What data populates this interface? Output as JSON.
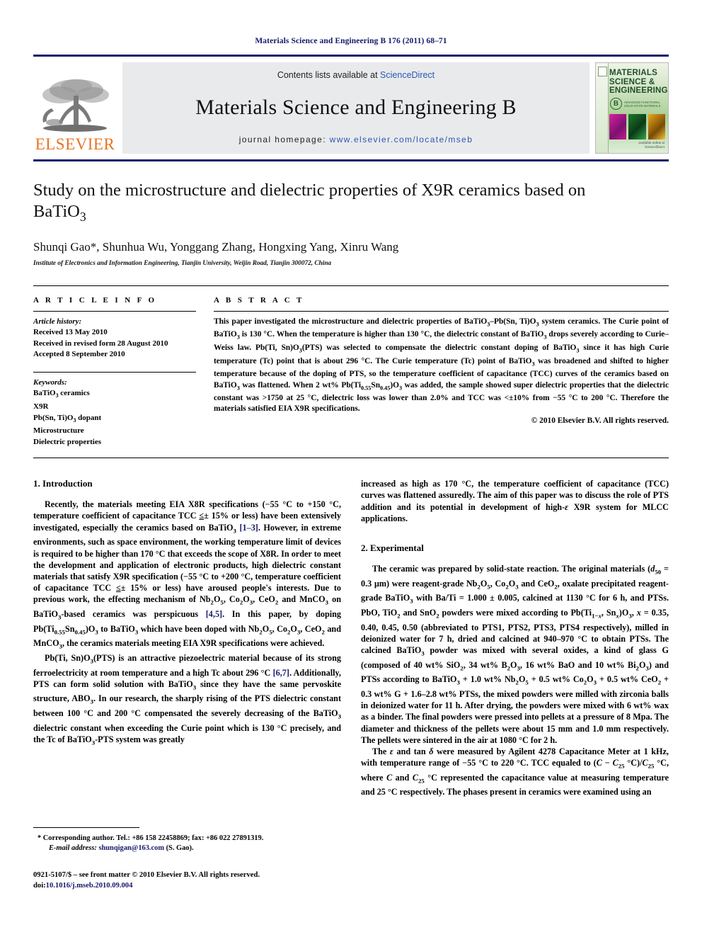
{
  "running_head": "Materials Science and Engineering B 176 (2011) 68–71",
  "masthead": {
    "publisher_name": "ELSEVIER",
    "contents_prefix": "Contents lists available at ",
    "contents_link": "ScienceDirect",
    "journal_title": "Materials Science and Engineering B",
    "homepage_prefix": "journal homepage:",
    "homepage_url": "www.elsevier.com/locate/mseb",
    "cover": {
      "title_line1": "MATERIALS",
      "title_line2": "SCIENCE &",
      "title_line3": "ENGINEERING",
      "series_letter": "B",
      "badge_line1": "ADVANCED FUNCTIONAL",
      "badge_line2": "SOLID-STATE MATERIALS",
      "foot_line1": "available online at",
      "foot_line2": "ScienceDirect"
    }
  },
  "article": {
    "title_part1": "Study on the microstructure and dielectric properties of X9R ceramics based on",
    "title_part2_pre": "BaTiO",
    "title_part2_sub": "3",
    "authors": "Shunqi Gao*, Shunhua Wu, Yonggang Zhang, Hongxing Yang, Xinru Wang",
    "affiliation": "Institute of Electronics and Information Engineering, Tianjin University, Weijin Road, Tianjin 300072, China"
  },
  "article_info": {
    "heading": "A R T I C L E   I N F O",
    "history_title": "Article history:",
    "history": [
      "Received 13 May 2010",
      "Received in revised form 28 August 2010",
      "Accepted 8 September 2010"
    ],
    "keywords_title": "Keywords:",
    "keywords": [
      "BaTiO3 ceramics",
      "X9R",
      "Pb(Sn, Ti)O3 dopant",
      "Microstructure",
      "Dielectric properties"
    ]
  },
  "abstract": {
    "heading": "A B S T R A C T",
    "text": "This paper investigated the microstructure and dielectric properties of BaTiO3–Pb(Sn, Ti)O3 system ceramics. The Curie point of BaTiO3 is 130 °C. When the temperature is higher than 130 °C, the dielectric constant of BaTiO3 drops severely according to Curie–Weiss law. Pb(Ti, Sn)O3(PTS) was selected to compensate the dielectric constant doping of BaTiO3 since it has high Curie temperature (Tc) point that is about 296 °C. The Curie temperature (Tc) point of BaTiO3 was broadened and shifted to higher temperature because of the doping of PTS, so the temperature coefficient of capacitance (TCC) curves of the ceramics based on BaTiO3 was flattened. When 2 wt% Pb(Ti0.55Sn0.45)O3 was added, the sample showed super dielectric properties that the dielectric constant was >1750 at 25 °C, dielectric loss was lower than 2.0% and TCC was <±10% from −55 °C to 200 °C. Therefore the materials satisfied EIA X9R specifications.",
    "copyright": "© 2010 Elsevier B.V. All rights reserved."
  },
  "sections": {
    "introduction_heading": "1.  Introduction",
    "experimental_heading": "2.  Experimental",
    "intro_p1": "Recently, the materials meeting EIA X8R specifications (−55 °C to +150 °C, temperature coefficient of capacitance TCC ≤± 15% or less) have been extensively investigated, especially the ceramics based on BaTiO3 [1–3]. However, in extreme environments, such as space environment, the working temperature limit of devices is required to be higher than 170 °C that exceeds the scope of X8R. In order to meet the development and application of electronic products, high dielectric constant materials that satisfy X9R specification (−55 °C to +200 °C, temperature coefficient of capacitance TCC ≤± 15% or less) have aroused people's interests. Due to previous work, the effecting mechanism of Nb2O5, Co2O3, CeO2 and MnCO3 on BaTiO3-based ceramics was perspicuous [4,5]. In this paper, by doping Pb(Ti0.55Sn0.45)O3 to BaTiO3 which have been doped with Nb2O5, Co2O3, CeO2 and MnCO3, the ceramics materials meeting EIA X9R specifications were achieved.",
    "intro_p2": "Pb(Ti, Sn)O3(PTS) is an attractive piezoelectric material because of its strong ferroelectricity at room temperature and a high Tc about 296 °C [6,7]. Additionally, PTS can form solid solution with BaTiO3 since they have the same pervoskite structure, ABO3. In our research, the sharply rising of the PTS dielectric constant between 100 °C and 200 °C compensated the severely decreasing of the BaTiO3 dielectric constant when exceeding the Curie point which is 130 °C precisely, and the Tc of BaTiO3-PTS system was greatly increased as high as 170 °C, the temperature coefficient of capacitance (TCC) curves was flattened assuredly. The aim of this paper was to discuss the role of PTS addition and its potential in development of high-ε X9R system for MLCC applications.",
    "exp_p1": "The ceramic was prepared by solid-state reaction. The original materials (d50 = 0.3 μm) were reagent-grade Nb2O5, Co2O3 and CeO2, oxalate precipitated reagent-grade BaTiO3 with Ba/Ti = 1.000 ± 0.005, calcined at 1130 °C for 6 h, and PTSs. PbO, TiO2 and SnO2 powders were mixed according to Pb(Ti1−x, Snx)O3, x = 0.35, 0.40, 0.45, 0.50 (abbreviated to PTS1, PTS2, PTS3, PTS4 respectively), milled in deionized water for 7 h, dried and calcined at 940–970 °C to obtain PTSs. The calcined BaTiO3 powder was mixed with several oxides, a kind of glass G (composed of 40 wt% SiO2, 34 wt% B2O3, 16 wt% BaO and 10 wt% Bi2O3) and PTSs according to BaTiO3 + 1.0 wt% Nb2O5 + 0.5 wt% Co2O3 + 0.5 wt% CeO2 + 0.3 wt% G + 1.6–2.8 wt% PTSs, the mixed powders were milled with zirconia balls in deionized water for 11 h. After drying, the powders were mixed with 6 wt% wax as a binder. The final powders were pressed into pellets at a pressure of 8 Mpa. The diameter and thickness of the pellets were about 15 mm and 1.0 mm respectively. The pellets were sintered in the air at 1080 °C for 2 h.",
    "exp_p2": "The ε and tan δ were measured by Agilent 4278 Capacitance Meter at 1 kHz, with temperature range of −55 °C to 220 °C. TCC equaled to (C − C25 °C)/C25 °C, where C and C25 °C represented the capacitance value at measuring temperature and 25 °C respectively. The phases present in ceramics were examined using an"
  },
  "footnotes": {
    "corresponding": "* Corresponding author. Tel.: +86 158 22458869; fax: +86 022 27891319.",
    "email_label": "E-mail address:",
    "email": "shunqigan@163.com",
    "email_suffix": " (S. Gao).",
    "imprint_line1": "0921-5107/$ – see front matter © 2010 Elsevier B.V. All rights reserved.",
    "doi_label": "doi:",
    "doi_value": "10.1016/j.mseb.2010.09.004"
  },
  "colors": {
    "navy": "#16196b",
    "link": "#2b57b4",
    "elsevier_orange": "#e87422",
    "band_grey": "#e9eaec"
  }
}
